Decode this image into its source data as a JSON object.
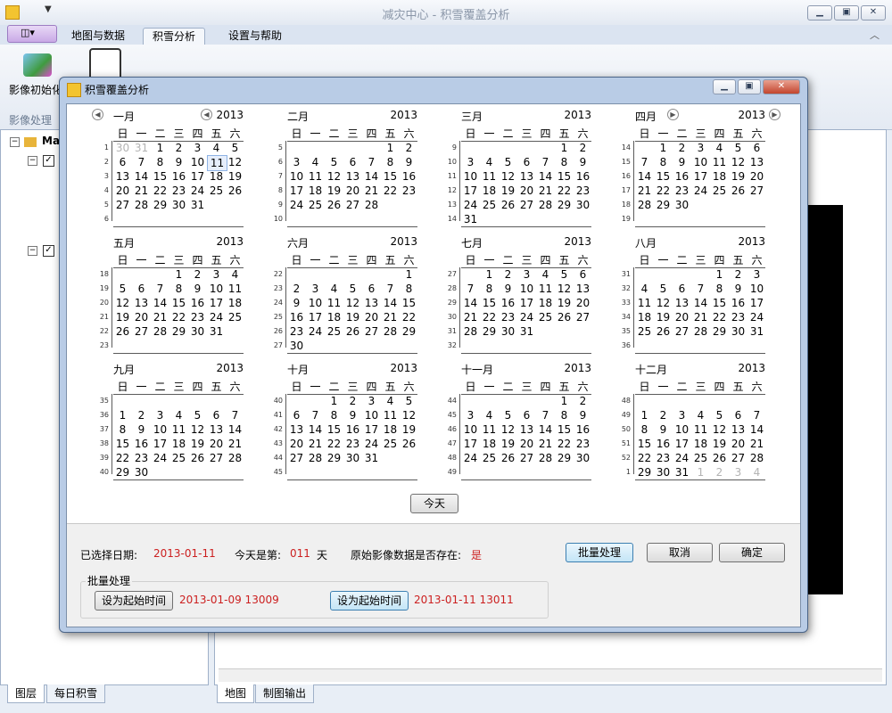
{
  "window": {
    "title": "减灾中心 - 积雪覆盖分析"
  },
  "ribbon": {
    "tabs": [
      "地图与数据",
      "积雪分析",
      "设置与帮助"
    ],
    "buttons": {
      "image_init": "影像初始化"
    },
    "group_label": "影像处理"
  },
  "left_panel": {
    "root_label": "Ma"
  },
  "bottom_tabs_left": [
    "图层",
    "每日积雪"
  ],
  "bottom_tabs_right": [
    "地图",
    "制图输出"
  ],
  "dialog": {
    "title": "积雪覆盖分析",
    "year": "2013",
    "weekdays": [
      "日",
      "一",
      "二",
      "三",
      "四",
      "五",
      "六"
    ],
    "months": [
      {
        "name": "一月",
        "weeks": [
          "1",
          "2",
          "3",
          "4",
          "5",
          "6"
        ],
        "days": [
          "30",
          "31",
          "1",
          "2",
          "3",
          "4",
          "5",
          "6",
          "7",
          "8",
          "9",
          "10",
          "11",
          "12",
          "13",
          "14",
          "15",
          "16",
          "17",
          "18",
          "19",
          "20",
          "21",
          "22",
          "23",
          "24",
          "25",
          "26",
          "27",
          "28",
          "29",
          "30",
          "31"
        ],
        "start": 0,
        "dim_prefix": 2,
        "selected": "11"
      },
      {
        "name": "二月",
        "weeks": [
          "5",
          "6",
          "7",
          "8",
          "9",
          "10"
        ],
        "days": [
          "1",
          "2",
          "3",
          "4",
          "5",
          "6",
          "7",
          "8",
          "9",
          "10",
          "11",
          "12",
          "13",
          "14",
          "15",
          "16",
          "17",
          "18",
          "19",
          "20",
          "21",
          "22",
          "23",
          "24",
          "25",
          "26",
          "27",
          "28"
        ],
        "start": 5
      },
      {
        "name": "三月",
        "weeks": [
          "9",
          "10",
          "11",
          "12",
          "13",
          "14"
        ],
        "days": [
          "1",
          "2",
          "3",
          "4",
          "5",
          "6",
          "7",
          "8",
          "9",
          "10",
          "11",
          "12",
          "13",
          "14",
          "15",
          "16",
          "17",
          "18",
          "19",
          "20",
          "21",
          "22",
          "23",
          "24",
          "25",
          "26",
          "27",
          "28",
          "29",
          "30",
          "31"
        ],
        "start": 5
      },
      {
        "name": "四月",
        "weeks": [
          "14",
          "15",
          "16",
          "17",
          "18",
          "19"
        ],
        "days": [
          "1",
          "2",
          "3",
          "4",
          "5",
          "6",
          "7",
          "8",
          "9",
          "10",
          "11",
          "12",
          "13",
          "14",
          "15",
          "16",
          "17",
          "18",
          "19",
          "20",
          "21",
          "22",
          "23",
          "24",
          "25",
          "26",
          "27",
          "28",
          "29",
          "30"
        ],
        "start": 1
      },
      {
        "name": "五月",
        "weeks": [
          "18",
          "19",
          "20",
          "21",
          "22",
          "23"
        ],
        "days": [
          "1",
          "2",
          "3",
          "4",
          "5",
          "6",
          "7",
          "8",
          "9",
          "10",
          "11",
          "12",
          "13",
          "14",
          "15",
          "16",
          "17",
          "18",
          "19",
          "20",
          "21",
          "22",
          "23",
          "24",
          "25",
          "26",
          "27",
          "28",
          "29",
          "30",
          "31"
        ],
        "start": 3
      },
      {
        "name": "六月",
        "weeks": [
          "22",
          "23",
          "24",
          "25",
          "26",
          "27"
        ],
        "days": [
          "1",
          "2",
          "3",
          "4",
          "5",
          "6",
          "7",
          "8",
          "9",
          "10",
          "11",
          "12",
          "13",
          "14",
          "15",
          "16",
          "17",
          "18",
          "19",
          "20",
          "21",
          "22",
          "23",
          "24",
          "25",
          "26",
          "27",
          "28",
          "29",
          "30"
        ],
        "start": 6
      },
      {
        "name": "七月",
        "weeks": [
          "27",
          "28",
          "29",
          "30",
          "31",
          "32"
        ],
        "days": [
          "1",
          "2",
          "3",
          "4",
          "5",
          "6",
          "7",
          "8",
          "9",
          "10",
          "11",
          "12",
          "13",
          "14",
          "15",
          "16",
          "17",
          "18",
          "19",
          "20",
          "21",
          "22",
          "23",
          "24",
          "25",
          "26",
          "27",
          "28",
          "29",
          "30",
          "31"
        ],
        "start": 1
      },
      {
        "name": "八月",
        "weeks": [
          "31",
          "32",
          "33",
          "34",
          "35",
          "36"
        ],
        "days": [
          "1",
          "2",
          "3",
          "4",
          "5",
          "6",
          "7",
          "8",
          "9",
          "10",
          "11",
          "12",
          "13",
          "14",
          "15",
          "16",
          "17",
          "18",
          "19",
          "20",
          "21",
          "22",
          "23",
          "24",
          "25",
          "26",
          "27",
          "28",
          "29",
          "30",
          "31"
        ],
        "start": 4
      },
      {
        "name": "九月",
        "weeks": [
          "35",
          "36",
          "37",
          "38",
          "39",
          "40"
        ],
        "days": [
          "1",
          "2",
          "3",
          "4",
          "5",
          "6",
          "7",
          "8",
          "9",
          "10",
          "11",
          "12",
          "13",
          "14",
          "15",
          "16",
          "17",
          "18",
          "19",
          "20",
          "21",
          "22",
          "23",
          "24",
          "25",
          "26",
          "27",
          "28",
          "29",
          "30"
        ],
        "start": 7
      },
      {
        "name": "十月",
        "weeks": [
          "40",
          "41",
          "42",
          "43",
          "44",
          "45"
        ],
        "days": [
          "1",
          "2",
          "3",
          "4",
          "5",
          "6",
          "7",
          "8",
          "9",
          "10",
          "11",
          "12",
          "13",
          "14",
          "15",
          "16",
          "17",
          "18",
          "19",
          "20",
          "21",
          "22",
          "23",
          "24",
          "25",
          "26",
          "27",
          "28",
          "29",
          "30",
          "31"
        ],
        "start": 2
      },
      {
        "name": "十一月",
        "weeks": [
          "44",
          "45",
          "46",
          "47",
          "48",
          "49"
        ],
        "days": [
          "1",
          "2",
          "3",
          "4",
          "5",
          "6",
          "7",
          "8",
          "9",
          "10",
          "11",
          "12",
          "13",
          "14",
          "15",
          "16",
          "17",
          "18",
          "19",
          "20",
          "21",
          "22",
          "23",
          "24",
          "25",
          "26",
          "27",
          "28",
          "29",
          "30"
        ],
        "start": 5
      },
      {
        "name": "十二月",
        "weeks": [
          "48",
          "49",
          "50",
          "51",
          "52",
          "1"
        ],
        "days": [
          "1",
          "2",
          "3",
          "4",
          "5",
          "6",
          "7",
          "8",
          "9",
          "10",
          "11",
          "12",
          "13",
          "14",
          "15",
          "16",
          "17",
          "18",
          "19",
          "20",
          "21",
          "22",
          "23",
          "24",
          "25",
          "26",
          "27",
          "28",
          "29",
          "30",
          "31",
          "1",
          "2",
          "3",
          "4"
        ],
        "start": 7,
        "dim_suffix": 4
      }
    ],
    "today_button": "今天",
    "selected_date_label": "已选择日期:",
    "selected_date_value": "2013-01-11",
    "today_is_label": "今天是第:",
    "today_is_value": "011",
    "today_is_unit": "天",
    "raw_exists_label": "原始影像数据是否存在:",
    "raw_exists_value": "是",
    "batch_button": "批量处理",
    "cancel_button": "取消",
    "ok_button": "确定",
    "batch_group_label": "批量处理",
    "set_start_button": "设为起始时间",
    "start_value": "2013-01-09 13009",
    "set_end_button": "设为起始时间",
    "end_value": "2013-01-11 13011"
  }
}
